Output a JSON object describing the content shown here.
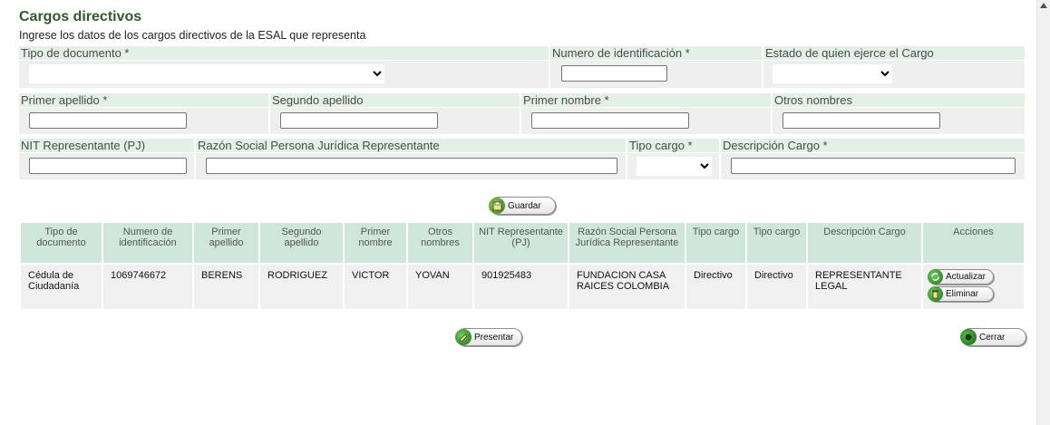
{
  "header": {
    "title": "Cargos directivos",
    "subtitle": "Ingrese los datos de los cargos directivos de la ESAL que representa"
  },
  "form": {
    "tipo_documento_label": "Tipo de documento *",
    "numero_identificacion_label": "Numero de identificación *",
    "estado_label": "Estado de quien ejerce el Cargo",
    "primer_apellido_label": "Primer apellido *",
    "segundo_apellido_label": "Segundo apellido",
    "primer_nombre_label": "Primer nombre *",
    "otros_nombres_label": "Otros nombres",
    "nit_label": "NIT Representante (PJ)",
    "razon_social_label": "Razón Social Persona Jurídica Representante",
    "tipo_cargo_label": "Tipo cargo *",
    "descripcion_label": "Descripción Cargo *"
  },
  "buttons": {
    "guardar": "Guardar",
    "presentar": "Presentar",
    "cerrar": "Cerrar",
    "actualizar": "Actualizar",
    "eliminar": "Eliminar"
  },
  "table": {
    "headers": [
      "Tipo de documento",
      "Numero de identificación",
      "Primer apellido",
      "Segundo apellido",
      "Primer nombre",
      "Otros nombres",
      "NIT Representante (PJ)",
      "Razón Social Persona Jurídica Representante",
      "Tipo cargo",
      "Tipo cargo",
      "Descripción Cargo",
      "Acciones"
    ],
    "rows": [
      [
        "Cédula de Ciudadanía",
        "1069746672",
        "BERENS",
        "RODRIGUEZ",
        "VICTOR",
        "YOVAN",
        "901925483",
        "FUNDACION CASA RAICES COLOMBIA",
        "Directivo",
        "Directivo",
        "REPRESENTANTE LEGAL"
      ]
    ]
  },
  "colors": {
    "label_bg": "#e3f0e6",
    "field_bg": "#efefef",
    "header_bg": "#cfe6db",
    "title_color": "#2d5a2d"
  },
  "icons": [
    "save-icon",
    "present-icon",
    "close-icon",
    "update-icon",
    "delete-icon"
  ]
}
